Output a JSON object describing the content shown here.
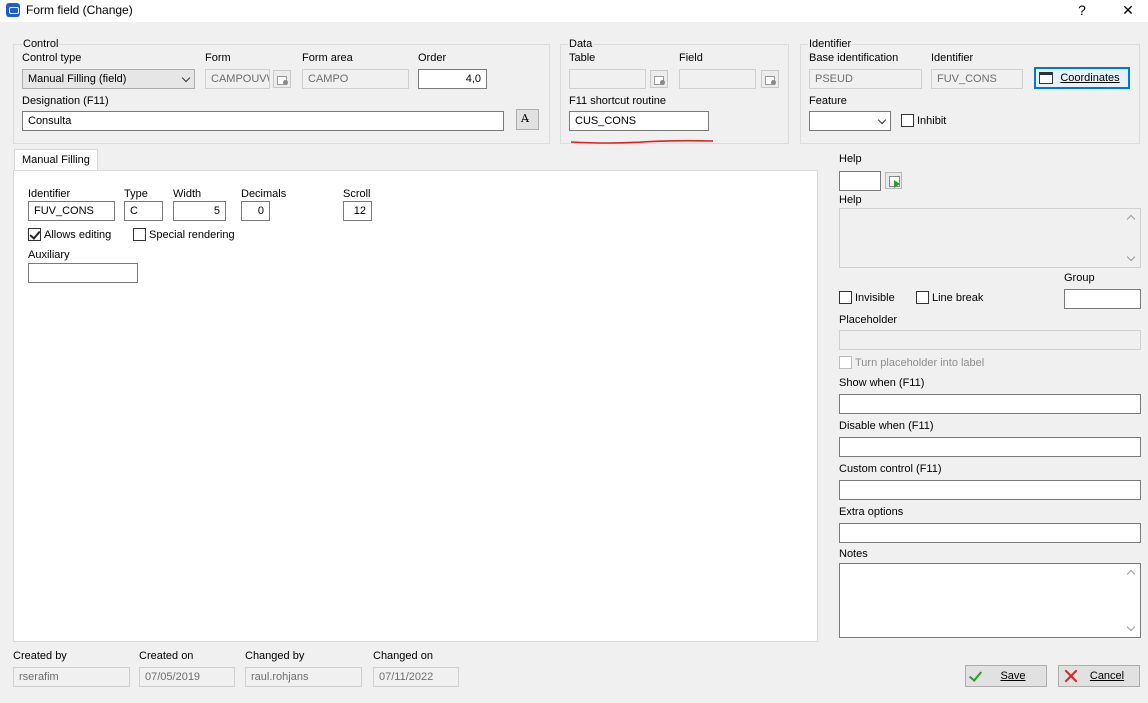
{
  "window": {
    "title": "Form field (Change)",
    "help_glyph": "?",
    "close_glyph": "✕"
  },
  "control": {
    "group_title": "Control",
    "control_type_label": "Control type",
    "control_type_value": "Manual Filling (field)",
    "form_label": "Form",
    "form_value": "CAMPOUVW",
    "form_area_label": "Form area",
    "form_area_value": "CAMPO",
    "order_label": "Order",
    "order_value": "4,0",
    "designation_label": "Designation (F11)",
    "designation_value": "Consulta"
  },
  "data_group": {
    "group_title": "Data",
    "table_label": "Table",
    "table_value": "",
    "field_label": "Field",
    "field_value": "",
    "f11_label": "F11 shortcut routine",
    "f11_value": "CUS_CONS"
  },
  "identifier_group": {
    "group_title": "Identifier",
    "base_label": "Base identification",
    "base_value": "PSEUD",
    "identifier_label": "Identifier",
    "identifier_value": "FUV_CONS",
    "coordinates_button": "Coordinates",
    "feature_label": "Feature",
    "feature_value": "",
    "inhibit_label": "Inhibit"
  },
  "tab": {
    "label": "Manual Filling",
    "identifier_label": "Identifier",
    "identifier_value": "FUV_CONS",
    "type_label": "Type",
    "type_value": "C",
    "width_label": "Width",
    "width_value": "5",
    "decimals_label": "Decimals",
    "decimals_value": "0",
    "scroll_label": "Scroll",
    "scroll_value": "12",
    "allows_editing_label": "Allows editing",
    "allows_editing_checked": true,
    "special_rendering_label": "Special rendering",
    "special_rendering_checked": false,
    "auxiliary_label": "Auxiliary",
    "auxiliary_value": ""
  },
  "right_panel": {
    "help_label": "Help",
    "help_code_value": "",
    "help_text_label": "Help",
    "group_label": "Group",
    "group_value": "",
    "invisible_label": "Invisible",
    "line_break_label": "Line break",
    "placeholder_label": "Placeholder",
    "placeholder_value": "",
    "turn_placeholder_label": "Turn placeholder into label",
    "show_when_label": "Show when (F11)",
    "show_when_value": "",
    "disable_when_label": "Disable when (F11)",
    "disable_when_value": "",
    "custom_control_label": "Custom control (F11)",
    "custom_control_value": "",
    "extra_options_label": "Extra options",
    "extra_options_value": "",
    "notes_label": "Notes"
  },
  "footer": {
    "created_by_label": "Created by",
    "created_by_value": "rserafim",
    "created_on_label": "Created on",
    "created_on_value": "07/05/2019",
    "changed_by_label": "Changed by",
    "changed_by_value": "raul.rohjans",
    "changed_on_label": "Changed on",
    "changed_on_value": "07/11/2022",
    "save_button": "Save",
    "cancel_button": "Cancel"
  },
  "colors": {
    "annotation_underline": "#e02020",
    "focus_accent": "#0078d7",
    "save_check": "#2d9b2d",
    "cancel_x": "#d92020"
  }
}
